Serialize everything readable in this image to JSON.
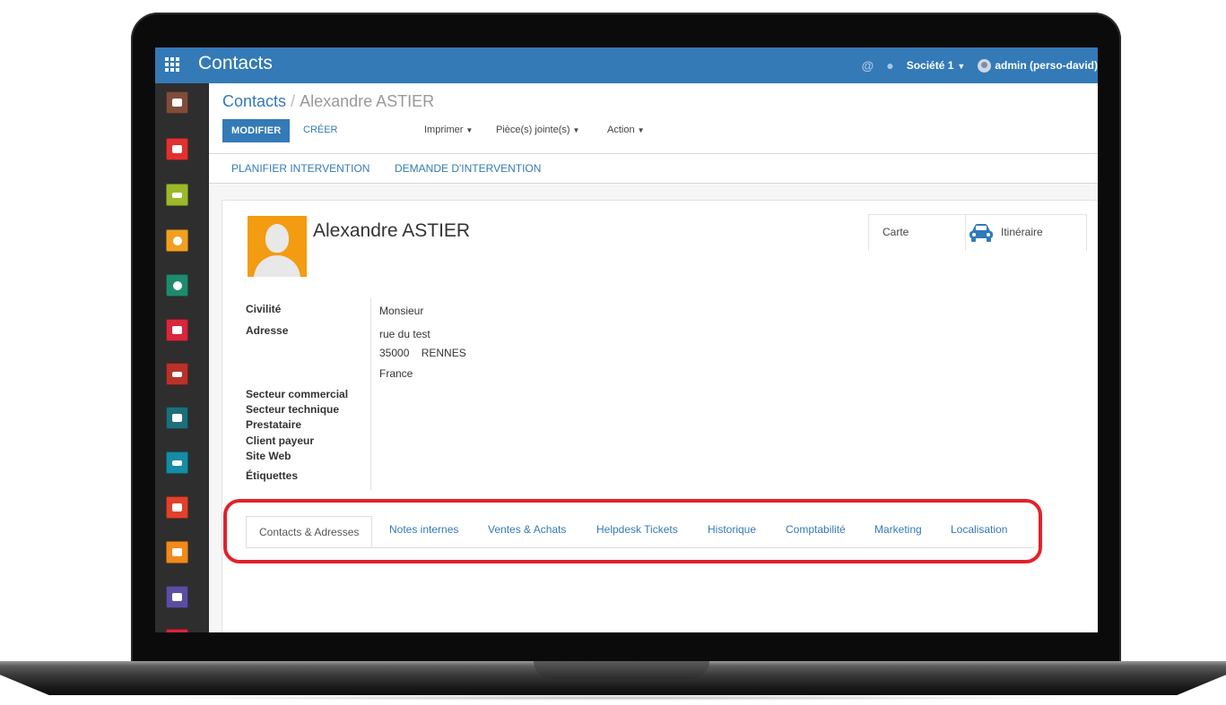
{
  "app": {
    "title": "Contacts"
  },
  "topbar": {
    "company": "Société 1",
    "user": "admin (perso-david)",
    "icons": [
      "at-icon",
      "chat-icon"
    ]
  },
  "sidebar": {
    "items": [
      {
        "icon": "discuss-icon",
        "color": "#7e4e3a"
      },
      {
        "icon": "mail-icon",
        "color": "#e03131"
      },
      {
        "icon": "calendar-icon",
        "color": "#9bb82c"
      },
      {
        "icon": "map-pin-icon",
        "color": "#f0a020"
      },
      {
        "icon": "contacts-icon",
        "color": "#1f8a6d"
      },
      {
        "icon": "folder-icon",
        "color": "#d7263d"
      },
      {
        "icon": "chart-icon",
        "color": "#b8322a"
      },
      {
        "icon": "document-icon",
        "color": "#1d6f7a"
      },
      {
        "icon": "card-icon",
        "color": "#178ca4"
      },
      {
        "icon": "building-icon",
        "color": "#e0412b"
      },
      {
        "icon": "file-icon",
        "color": "#f08a1c"
      },
      {
        "icon": "puzzle-icon",
        "color": "#5b4ea0"
      },
      {
        "icon": "support-icon",
        "color": "#d7263d"
      }
    ]
  },
  "breadcrumb": {
    "parent": "Contacts",
    "separator": "/",
    "current": "Alexandre ASTIER"
  },
  "buttons": {
    "modifier": "MODIFIER",
    "creer": "CRÉER"
  },
  "menus": {
    "imprimer": "Imprimer",
    "pieces": "Pièce(s) jointe(s)",
    "action": "Action"
  },
  "status_actions": {
    "planifier": "PLANIFIER INTERVENTION",
    "demande": "DEMANDE D'INTERVENTION"
  },
  "contact": {
    "name": "Alexandre ASTIER",
    "smart_buttons": {
      "carte": "Carte",
      "itineraire": "Itinéraire"
    },
    "labels": {
      "civilite": "Civilité",
      "adresse": "Adresse",
      "secteur_commercial": "Secteur commercial",
      "secteur_technique": "Secteur technique",
      "prestataire": "Prestataire",
      "client_payeur": "Client payeur",
      "site_web": "Site Web",
      "etiquettes": "Étiquettes"
    },
    "values": {
      "civilite": "Monsieur",
      "street": "rue du test",
      "city_line": "35000    RENNES",
      "country": "France"
    }
  },
  "tabs": [
    "Contacts & Adresses",
    "Notes internes",
    "Ventes & Achats",
    "Helpdesk Tickets",
    "Historique",
    "Comptabilité",
    "Marketing",
    "Localisation"
  ],
  "colors": {
    "primary": "#337ab7",
    "highlight": "#e3212b",
    "avatar": "#f39c12"
  }
}
